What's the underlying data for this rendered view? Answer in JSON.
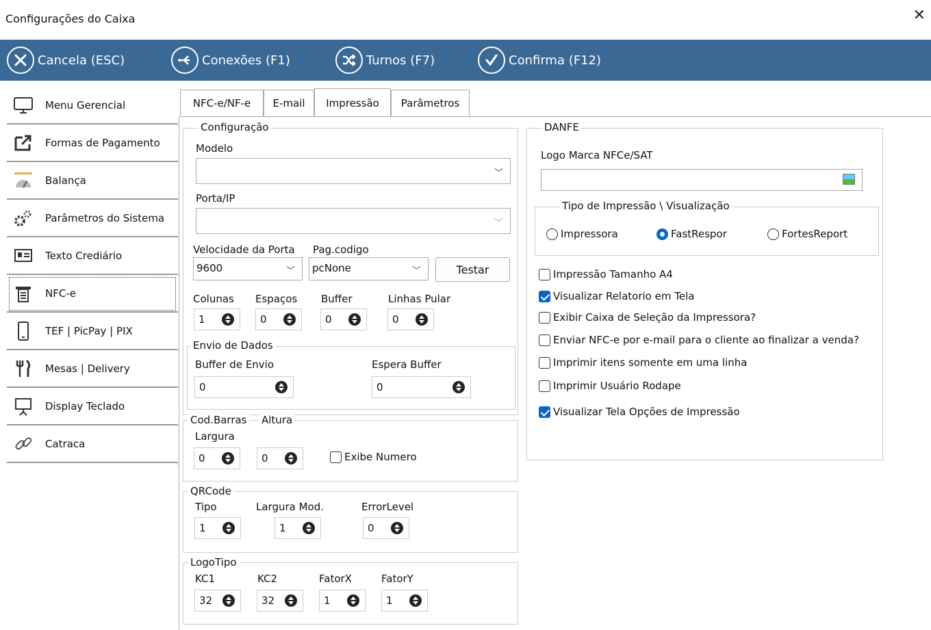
{
  "window": {
    "title": "Configurações do Caixa",
    "close": "✕"
  },
  "toolbar": {
    "cancel": "Cancela (ESC)",
    "connections": "Conexões (F1)",
    "shifts": "Turnos (F7)",
    "confirm": "Confirma (F12)"
  },
  "sidebar": {
    "items": [
      {
        "label": "Menu Gerencial",
        "icon": "monitor-icon"
      },
      {
        "label": "Formas de Pagamento",
        "icon": "export-icon"
      },
      {
        "label": "Balança",
        "icon": "gauge-icon"
      },
      {
        "label": "Parâmetros do Sistema",
        "icon": "gears-icon"
      },
      {
        "label": "Texto Crediário",
        "icon": "id-card-icon"
      },
      {
        "label": "NFC-e",
        "icon": "receipt-icon"
      },
      {
        "label": "TEF | PicPay | PIX",
        "icon": "phone-icon"
      },
      {
        "label": "Mesas | Delivery",
        "icon": "cutlery-icon"
      },
      {
        "label": "Display Teclado",
        "icon": "presentation-icon"
      },
      {
        "label": "Catraca",
        "icon": "link-icon"
      }
    ]
  },
  "tabs": [
    "NFC-e/NF-e",
    "E-mail",
    "Impressão",
    "Parâmetros"
  ],
  "config": {
    "title": "Configuração",
    "modelo_label": "Modelo",
    "modelo_value": "",
    "porta_label": "Porta/IP",
    "porta_value": "",
    "velocidade_label": "Velocidade da Porta",
    "velocidade_value": "9600",
    "pagcodigo_label": "Pag.codigo",
    "pagcodigo_value": "pcNone",
    "testar": "Testar",
    "colunas_label": "Colunas",
    "colunas": "1",
    "espacos_label": "Espaços",
    "espacos": "0",
    "buffer_label": "Buffer",
    "buffer": "0",
    "linhas_label": "Linhas Pular",
    "linhas": "0"
  },
  "envio": {
    "title": "Envio de Dados",
    "buffer_envio_label": "Buffer de Envio",
    "buffer_envio": "0",
    "espera_label": "Espera Buffer",
    "espera": "0"
  },
  "codbarras": {
    "title": "Cod.Barras",
    "altura_label": "Altura",
    "largura_label": "Largura",
    "largura": "0",
    "altura": "0",
    "exibe_numero": "Exibe Numero"
  },
  "qrcode": {
    "title": "QRCode",
    "tipo_label": "Tipo",
    "tipo": "1",
    "largura_mod_label": "Largura Mod.",
    "largura_mod": "1",
    "error_label": "ErrorLevel",
    "error": "0"
  },
  "logotipo": {
    "title": "LogoTipo",
    "kc1_label": "KC1",
    "kc1": "32",
    "kc2_label": "KC2",
    "kc2": "32",
    "fatorx_label": "FatorX",
    "fatorx": "1",
    "fatory_label": "FatorY",
    "fatory": "1"
  },
  "danfe": {
    "title": "DANFE",
    "logo_label": "Logo Marca NFCe/SAT",
    "logo_value": "",
    "tipo_title": "Tipo de Impressão \\ Visualização",
    "radio_impressora": "Impressora",
    "radio_fastrespor": "FastRespor",
    "radio_fortes": "FortesReport",
    "selected_radio": "FastRespor",
    "checks": [
      {
        "label": "Impressão Tamanho A4",
        "checked": false
      },
      {
        "label": "Visualizar Relatorio em Tela",
        "checked": true
      },
      {
        "label": "Exibir Caixa de Seleção da Impressora?",
        "checked": false
      },
      {
        "label": "Enviar NFC-e por e-mail para o cliente ao finalizar a venda?",
        "checked": false
      },
      {
        "label": "Imprimir itens somente em uma linha",
        "checked": false
      },
      {
        "label": "Imprimir Usuário Rodape",
        "checked": false
      },
      {
        "label": "Visualizar Tela Opções de Impressão",
        "checked": true
      }
    ]
  },
  "colors": {
    "toolbar": "#3b6996",
    "accent": "#0b64c8"
  }
}
